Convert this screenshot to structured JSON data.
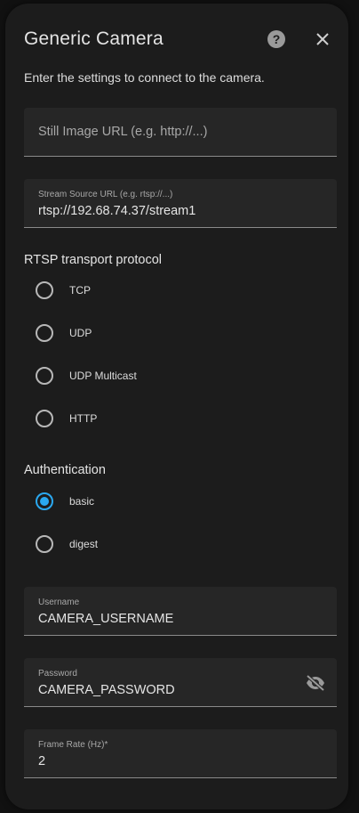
{
  "dialog": {
    "title": "Generic Camera",
    "description": "Enter the settings to connect to the camera."
  },
  "fields": {
    "still_image_url": {
      "placeholder": "Still Image URL (e.g. http://...)",
      "value": ""
    },
    "stream_source": {
      "label": "Stream Source URL (e.g. rtsp://...)",
      "value": "rtsp://192.68.74.37/stream1"
    },
    "username": {
      "label": "Username",
      "value": "CAMERA_USERNAME"
    },
    "password": {
      "label": "Password",
      "value": "CAMERA_PASSWORD"
    },
    "frame_rate": {
      "label": "Frame Rate (Hz)*",
      "value": "2"
    }
  },
  "rtsp": {
    "title": "RTSP transport protocol",
    "options": [
      "TCP",
      "UDP",
      "UDP Multicast",
      "HTTP"
    ],
    "selected": null
  },
  "auth": {
    "title": "Authentication",
    "options": [
      "basic",
      "digest"
    ],
    "selected": "basic"
  },
  "icons": {
    "help": "help-circle-icon",
    "close": "close-icon",
    "password_toggle": "eye-off-icon"
  },
  "colors": {
    "accent": "#2aa8f0",
    "dialog_bg": "#1c1c1c",
    "field_bg": "#262626"
  }
}
